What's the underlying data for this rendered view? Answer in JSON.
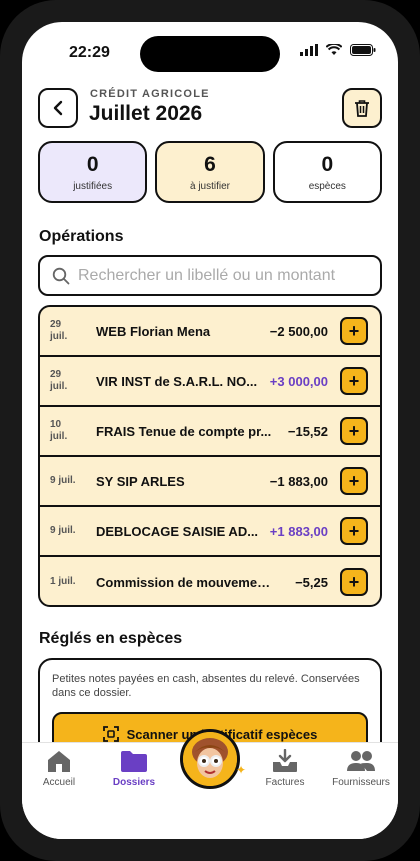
{
  "status": {
    "time": "22:29"
  },
  "header": {
    "bank": "CRÉDIT AGRICOLE",
    "month": "Juillet 2026"
  },
  "stats": [
    {
      "num": "0",
      "label": "justifiées"
    },
    {
      "num": "6",
      "label": "à justifier"
    },
    {
      "num": "0",
      "label": "espèces"
    }
  ],
  "operations": {
    "title": "Opérations",
    "search_placeholder": "Rechercher un libellé ou un montant",
    "items": [
      {
        "date": "29\njuil.",
        "label": "WEB Florian Mena",
        "amount": "−2 500,00"
      },
      {
        "date": "29\njuil.",
        "label": "VIR INST de S.A.R.L. NO...",
        "amount": "+3 000,00"
      },
      {
        "date": "10\njuil.",
        "label": "FRAIS Tenue de compte pr...",
        "amount": "−15,52"
      },
      {
        "date": "9 juil.",
        "label": "SY SIP ARLES",
        "amount": "−1 883,00"
      },
      {
        "date": "9 juil.",
        "label": "DEBLOCAGE SAISIE AD...",
        "amount": "+1 883,00"
      },
      {
        "date": "1 juil.",
        "label": "Commission de mouvement...",
        "amount": "−5,25"
      }
    ]
  },
  "cash": {
    "title": "Réglés en espèces",
    "description": "Petites notes payées en cash, absentes du relevé. Conservées dans ce dossier.",
    "scan_label": "Scanner un justificatif espèces"
  },
  "tabs": [
    {
      "label": "Accueil",
      "icon": "home-icon"
    },
    {
      "label": "Dossiers",
      "icon": "folder-icon"
    },
    {
      "label": "Factures",
      "icon": "inbox-download-icon"
    },
    {
      "label": "Fournisseurs",
      "icon": "people-icon"
    }
  ],
  "colors": {
    "accent": "#f5b41b",
    "purple": "#6a3fc4",
    "cream": "#fdf0cf",
    "lavender": "#ece8fb"
  }
}
